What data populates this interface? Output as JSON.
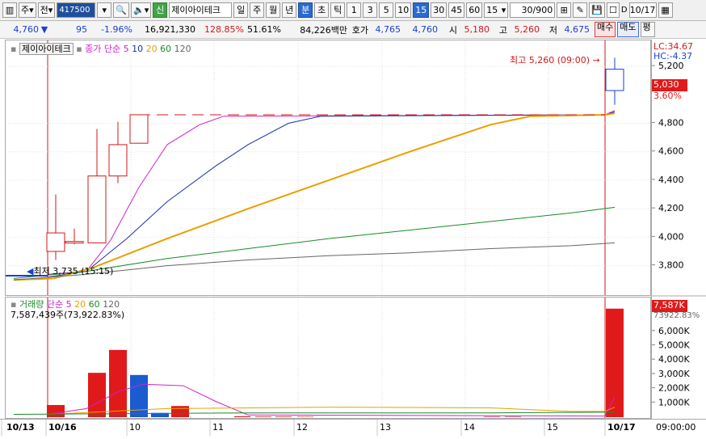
{
  "toolbar": {
    "code": "417500",
    "market_type": "주",
    "period_mode": "전",
    "badge": "신",
    "stock_name": "제이아이테크",
    "periods": [
      "일",
      "주",
      "월",
      "년",
      "분",
      "초",
      "틱"
    ],
    "intervals": [
      "1",
      "3",
      "5",
      "10",
      "15",
      "30",
      "45",
      "60"
    ],
    "interval_active": "15",
    "interval_select": "15",
    "count": "30",
    "count_total": "/900",
    "date": "10/17"
  },
  "quote": {
    "price": "4,760",
    "change_icon": "down-triangle-icon",
    "change": "95",
    "change_pct": "-1.96%",
    "volume": "16,921,330",
    "vol_ratio": "128.85%",
    "turnover": "51.61%",
    "amount": "84,226백만",
    "ask_label": "호가",
    "ask": "4,765",
    "bid": "4,760",
    "open_label": "시",
    "open": "5,180",
    "high_label": "고",
    "high": "5,260",
    "low_label": "저",
    "low": "4,675",
    "buy_label": "매수",
    "sell_label": "매도",
    "eval_label": "평"
  },
  "price_chart": {
    "name_tag": "제이아이테크",
    "legend_label": "종가 단순",
    "ma": [
      {
        "period": "5",
        "color": "#cc22cc"
      },
      {
        "period": "10",
        "color": "#1a2fa8"
      },
      {
        "period": "20",
        "color": "#e8a000"
      },
      {
        "period": "60",
        "color": "#1a8a2a"
      },
      {
        "period": "120",
        "color": "#666666"
      }
    ],
    "high_annotation": "최고 5,260 (09:00)",
    "low_annotation": "최저 3,735 (15:15)",
    "lc_label": "LC:34.67",
    "hc_label": "HC:-4.37",
    "current_price_box": "5,030",
    "current_pct_box": "3.60%",
    "axis_ticks": [
      "5,200",
      "4,800",
      "4,600",
      "4,400",
      "4,200",
      "4,000",
      "3,800"
    ]
  },
  "volume_chart": {
    "legend_label": "거래량",
    "legend_ma_label": "단순",
    "ma": [
      {
        "period": "5",
        "color": "#cc22cc"
      },
      {
        "period": "20",
        "color": "#e8a000"
      },
      {
        "period": "60",
        "color": "#1a8a2a"
      },
      {
        "period": "120",
        "color": "#666666"
      }
    ],
    "current_text": "7,587,439주(73,922.83%)",
    "current_box": "7,587K",
    "current_pct_box": "73922.83%",
    "axis_ticks": [
      "6,000K",
      "5,000K",
      "4,000K",
      "3,000K",
      "2,000K",
      "1,000K"
    ]
  },
  "time_axis": {
    "labels": [
      "10/13",
      "10/16",
      "10",
      "11",
      "12",
      "13",
      "14",
      "15",
      "10/17"
    ],
    "right_label": "09:00:00"
  },
  "chart_data": {
    "type": "candlestick",
    "title": "",
    "x_unit": "15-minute bars",
    "price_ylim": [
      3650,
      5280
    ],
    "candles": [
      {
        "label": "10/16 09:00",
        "open": 3900,
        "high": 4300,
        "low": 3840,
        "close": 4030
      },
      {
        "label": "10/16 09:15",
        "open": 3960,
        "high": 4060,
        "low": 3950,
        "close": 3970
      },
      {
        "label": "10/16 09:30",
        "open": 3960,
        "high": 4760,
        "low": 3960,
        "close": 4430
      },
      {
        "label": "10/16 09:45",
        "open": 4430,
        "high": 4810,
        "low": 4380,
        "close": 4650
      },
      {
        "label": "10/16 10:00",
        "open": 4660,
        "high": 4860,
        "low": 4660,
        "close": 4860
      },
      {
        "label": "10/17 09:00",
        "open": 5180,
        "high": 5260,
        "low": 4930,
        "close": 5030
      }
    ],
    "volume_ylim": [
      0,
      7800
    ],
    "volume_unit": "K",
    "volumes": [
      {
        "label": "10/16 09:00",
        "value": 850,
        "color": "red"
      },
      {
        "label": "10/16 09:30",
        "value": 3100,
        "color": "red"
      },
      {
        "label": "10/16 09:45",
        "value": 4700,
        "color": "red"
      },
      {
        "label": "10/16 10:00",
        "value": 2950,
        "color": "blue"
      },
      {
        "label": "10/16 10:15",
        "value": 300,
        "color": "blue"
      },
      {
        "label": "10/16 10:45",
        "value": 780,
        "color": "red"
      },
      {
        "label": "10/17 09:00",
        "value": 7587,
        "color": "red"
      }
    ],
    "grid": true
  }
}
